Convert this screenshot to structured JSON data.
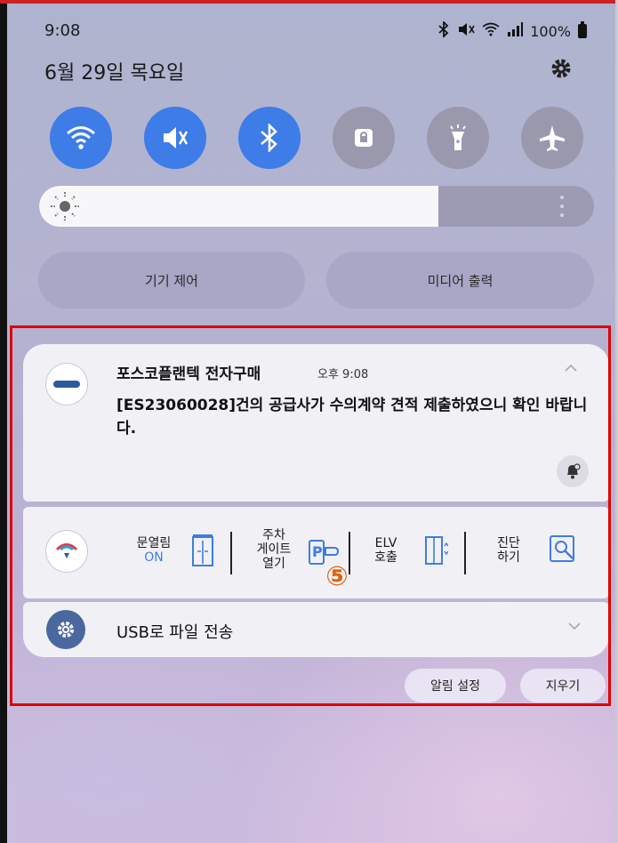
{
  "status_bar": {
    "time": "9:08",
    "battery": "100%",
    "icons": [
      "bluetooth-icon",
      "mute-icon",
      "wifi-icon",
      "signal-icon",
      "battery-icon"
    ]
  },
  "header": {
    "date": "6월 29일 목요일",
    "settings_icon": "gear-icon"
  },
  "quick_settings": [
    {
      "icon": "wifi-icon",
      "state": "on"
    },
    {
      "icon": "mute-icon",
      "state": "on"
    },
    {
      "icon": "bluetooth-icon",
      "state": "on"
    },
    {
      "icon": "lock-icon",
      "state": "off"
    },
    {
      "icon": "flashlight-icon",
      "state": "off"
    },
    {
      "icon": "airplane-icon",
      "state": "off"
    }
  ],
  "brightness": {
    "level": 0.72
  },
  "controls": {
    "device_control": "기기 제어",
    "media_output": "미디어 출력"
  },
  "notification": {
    "app_name": "포스코플랜텍 전자구매",
    "time": "오후 9:08",
    "body": "[ES23060028]건의 공급사가 수의계약 견적 제출하였으니 확인 바랍니다."
  },
  "iot_widget": {
    "items": [
      {
        "line1": "문열림",
        "line2": "ON"
      },
      {
        "line1": "주차",
        "line2": "게이트",
        "line3": "열기"
      },
      {
        "line1": "ELV",
        "line2": "호출"
      },
      {
        "line1": "진단",
        "line2": "하기"
      }
    ]
  },
  "annotation": {
    "badge": "⑤"
  },
  "usb": {
    "title": "USB로 파일 전송"
  },
  "actions": {
    "notification_settings": "알림 설정",
    "clear": "지우기"
  },
  "colors": {
    "accent": "#3e7ce7",
    "highlight_box": "#e00000",
    "badge": "#e06010"
  }
}
